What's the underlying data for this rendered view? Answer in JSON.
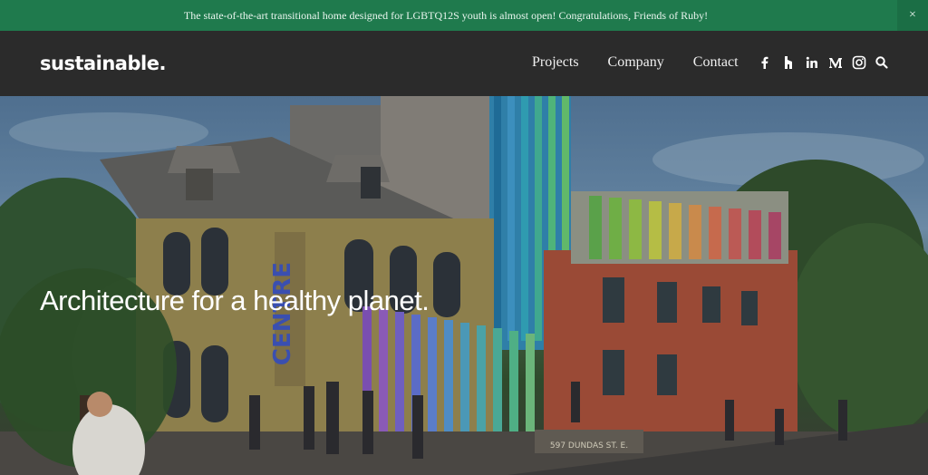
{
  "banner": {
    "message": "The state-of-the-art transitional home designed for LGBTQ12S youth is almost open! Congratulations, Friends of Ruby!",
    "close_label": "×"
  },
  "header": {
    "logo": "sustainable.",
    "nav": [
      "Projects",
      "Company",
      "Contact"
    ],
    "social_icons": [
      "facebook-icon",
      "houzz-icon",
      "linkedin-icon",
      "medium-icon",
      "instagram-icon"
    ],
    "search_icon": "search-icon"
  },
  "hero": {
    "title": "Architecture for a healthy planet."
  }
}
